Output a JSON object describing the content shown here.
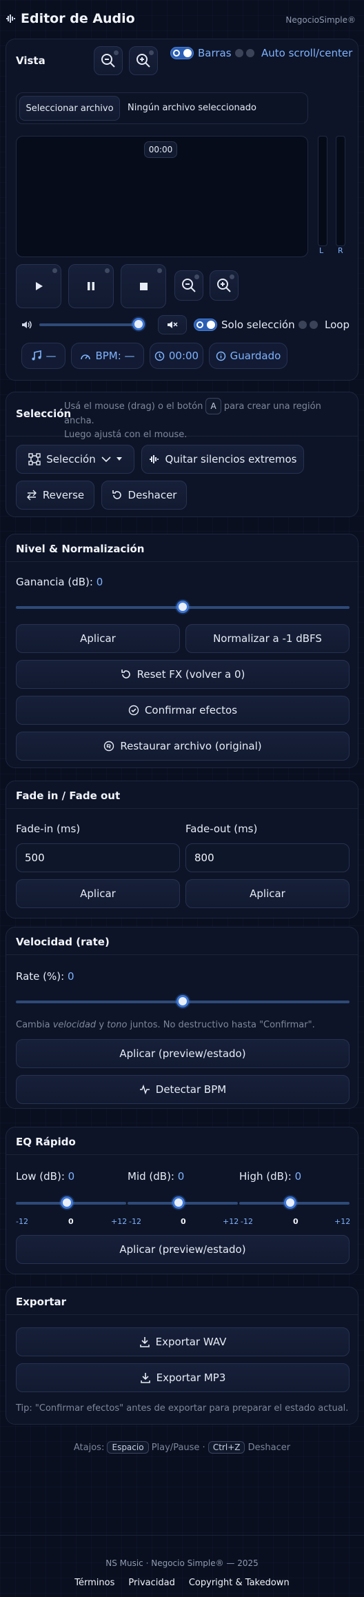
{
  "header": {
    "title": "Editor de Audio",
    "brand": "NegocioSimple®"
  },
  "vista": {
    "title": "Vista",
    "toggle_bars": "Barras",
    "toggle_autoscroll": "Auto scroll/center",
    "file_button": "Seleccionar archivo",
    "file_status": "Ningún archivo seleccionado",
    "time_badge": "00:00",
    "meter_left": "L",
    "meter_right": "R",
    "solo_seleccion": "Solo selección",
    "loop": "Loop",
    "chip_note": "—",
    "chip_bpm": "BPM: —",
    "chip_time": "00:00",
    "chip_status": "Guardado",
    "volume_level": 1.0
  },
  "seleccion": {
    "title": "Selección",
    "hint_prefix": "Usá el mouse (drag) o el botón",
    "hint_key": "A",
    "hint_suffix": "para crear una región ancha.",
    "hint_line2": "Luego ajustá con el mouse.",
    "select_label": "Selección",
    "silence_button": "Quitar silencios extremos",
    "reverse_button": "Reverse",
    "undo_button": "Deshacer"
  },
  "nivel": {
    "title": "Nivel & Normalización",
    "gain_label": "Ganancia (dB):",
    "gain_value": "0",
    "gain_level": 0.5,
    "apply_button": "Aplicar",
    "normalize_button": "Normalizar a -1 dBFS",
    "reset_button": "Reset FX (volver a 0)",
    "confirm_button": "Confirmar efectos",
    "restore_button": "Restaurar archivo (original)"
  },
  "fade": {
    "title": "Fade in / Fade out",
    "fadein_label": "Fade-in (ms)",
    "fadein_value": "500",
    "fadeout_label": "Fade-out (ms)",
    "fadeout_value": "800",
    "apply_in": "Aplicar",
    "apply_out": "Aplicar"
  },
  "rate": {
    "title": "Velocidad (rate)",
    "label": "Rate (%):",
    "value": "0",
    "level": 0.5,
    "note_prefix": "Cambia",
    "note_em1": "velocidad",
    "note_mid": "y",
    "note_em2": "tono",
    "note_suffix": "juntos. No destructivo hasta \"Confirmar\".",
    "apply_button": "Aplicar (preview/estado)",
    "bpm_button": "Detectar BPM"
  },
  "eq": {
    "title": "EQ Rápido",
    "low_label": "Low (dB):",
    "low_value": "0",
    "mid_label": "Mid (dB):",
    "mid_value": "0",
    "high_label": "High (dB):",
    "high_value": "0",
    "tick_min": "-12",
    "tick_mid": "0",
    "tick_max": "+12",
    "low_level": 0.5,
    "mid_level": 0.5,
    "high_level": 0.5,
    "apply_button": "Aplicar (preview/estado)"
  },
  "export": {
    "title": "Exportar",
    "wav_button": "Exportar WAV",
    "mp3_button": "Exportar MP3",
    "tip": "Tip: \"Confirmar efectos\" antes de exportar para preparar el estado actual."
  },
  "shortcuts": {
    "prefix": "Atajos:",
    "key1": "Espacio",
    "label1": "Play/Pause ·",
    "key2": "Ctrl+Z",
    "label2": "Deshacer"
  },
  "footer": {
    "copyright": "NS Music · Negocio Simple® — 2025",
    "link_terms": "Términos",
    "link_privacy": "Privacidad",
    "link_copyright": "Copyright & Takedown"
  },
  "colors": {
    "accent": "#3c76d6",
    "accent_text": "#7fb3ff",
    "background": "#090f1f"
  }
}
